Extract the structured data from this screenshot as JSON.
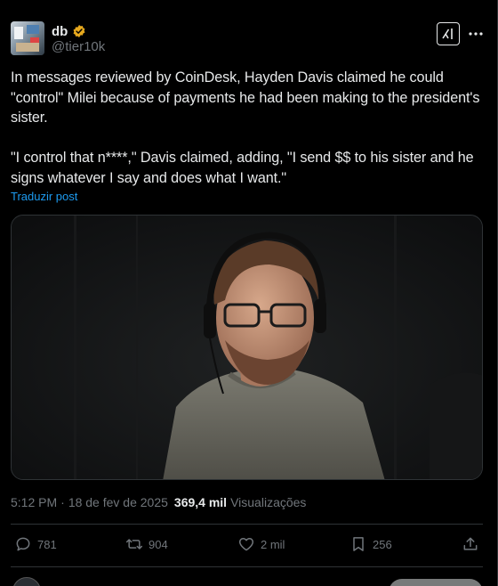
{
  "author": {
    "display_name": "db",
    "handle": "@tier10k",
    "verified": true,
    "verified_color": "#e7a91e"
  },
  "header": {
    "grok_icon": "grok-icon",
    "more_icon": "more-icon"
  },
  "post": {
    "text": "In messages reviewed by CoinDesk, Hayden Davis claimed he could \"control\" Milei because of payments he had been making to the president's sister.\n\n\"I control that n****,\" Davis claimed, adding, \"I send $$ to his sister and he signs whatever I say and does what I want.\"",
    "translate_label": "Traduzir post",
    "media_description_icon": "video-thumbnail"
  },
  "meta": {
    "time": "5:12 PM",
    "separator": "·",
    "date": "18 de fev de 2025",
    "views_count": "369,4 mil",
    "views_label": "Visualizações"
  },
  "actions": {
    "replies": "781",
    "reposts": "904",
    "likes": "2 mil",
    "bookmarks": "256"
  },
  "colors": {
    "background": "#000000",
    "text": "#e7e9ea",
    "muted": "#71767b",
    "link": "#1d9bf0",
    "border": "#2f3336"
  }
}
